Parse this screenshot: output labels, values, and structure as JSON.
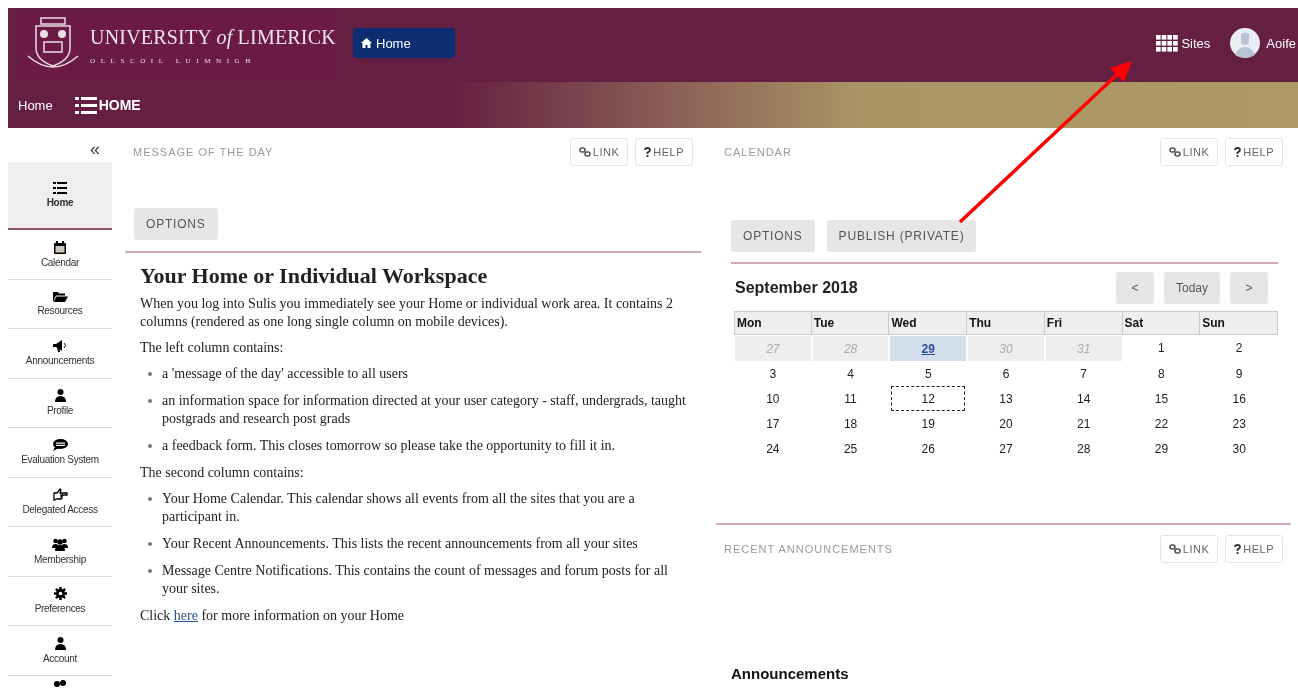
{
  "header": {
    "logo_title": "UNIVERSITY *of* LIMERICK",
    "logo_subtitle": "OLLSCOIL LUIMNIGH",
    "home_button": "Home",
    "sites": "Sites",
    "user": "Aoife"
  },
  "breadcrumb": {
    "home": "Home",
    "current": "HOME"
  },
  "sidebar": {
    "collapse": "«",
    "items": [
      {
        "label": "Home",
        "selected": true
      },
      {
        "label": "Calendar",
        "selected": false
      },
      {
        "label": "Resources",
        "selected": false
      },
      {
        "label": "Announcements",
        "selected": false
      },
      {
        "label": "Profile",
        "selected": false
      },
      {
        "label": "Evaluation System",
        "selected": false
      },
      {
        "label": "Delegated Access",
        "selected": false
      },
      {
        "label": "Membership",
        "selected": false
      },
      {
        "label": "Preferences",
        "selected": false
      },
      {
        "label": "Account",
        "selected": false
      }
    ]
  },
  "message_of_the_day": {
    "title": "MESSAGE OF THE DAY",
    "link": "LINK",
    "help": "HELP",
    "options": "OPTIONS",
    "heading": "Your Home or Individual Workspace",
    "blocks": [
      {
        "kind": "p",
        "text": "When you log into Sulis you immediately see your Home or individual work area. It contains 2 columns (rendered as one long single column on mobile devices)."
      },
      {
        "kind": "p",
        "text": "The left column contains:"
      },
      {
        "kind": "ul",
        "items": [
          "a 'message of the day'  accessible to all users",
          "an information space for information directed at your user category -  staff, undergrads, taught postgrads and research post grads",
          "a feedback form. This closes tomorrow so please take the opportunity to fill it in."
        ]
      },
      {
        "kind": "p",
        "text": "The second column contains:"
      },
      {
        "kind": "ul",
        "items": [
          "Your Home Calendar. This calendar shows all events from all the sites that you are a participant in.",
          "Your Recent Announcements. This lists the recent announcements from all your sites",
          "Message Centre Notifications. This contains the count of messages and forum posts for all your sites."
        ]
      },
      {
        "kind": "link_p",
        "before": "Click",
        "link": "here",
        "after": "for more information on your Home"
      }
    ]
  },
  "calendar": {
    "title": "CALENDAR",
    "link": "LINK",
    "help": "HELP",
    "options": "OPTIONS",
    "publish": "PUBLISH (PRIVATE)",
    "month": "September 2018",
    "prev": "<",
    "today": "Today",
    "next": ">",
    "weekdays": [
      "Mon",
      "Tue",
      "Wed",
      "Thu",
      "Fri",
      "Sat",
      "Sun"
    ],
    "weeks": [
      [
        {
          "day": "27",
          "muted": true,
          "selected": false,
          "today": false
        },
        {
          "day": "28",
          "muted": true,
          "selected": false,
          "today": false
        },
        {
          "day": "29",
          "muted": true,
          "selected": true,
          "today": false
        },
        {
          "day": "30",
          "muted": true,
          "selected": false,
          "today": false
        },
        {
          "day": "31",
          "muted": true,
          "selected": false,
          "today": false
        },
        {
          "day": "1",
          "muted": false,
          "selected": false,
          "today": false
        },
        {
          "day": "2",
          "muted": false,
          "selected": false,
          "today": false
        }
      ],
      [
        {
          "day": "3",
          "muted": false,
          "selected": false,
          "today": false
        },
        {
          "day": "4",
          "muted": false,
          "selected": false,
          "today": false
        },
        {
          "day": "5",
          "muted": false,
          "selected": false,
          "today": false
        },
        {
          "day": "6",
          "muted": false,
          "selected": false,
          "today": false
        },
        {
          "day": "7",
          "muted": false,
          "selected": false,
          "today": false
        },
        {
          "day": "8",
          "muted": false,
          "selected": false,
          "today": false
        },
        {
          "day": "9",
          "muted": false,
          "selected": false,
          "today": false
        }
      ],
      [
        {
          "day": "10",
          "muted": false,
          "selected": false,
          "today": false
        },
        {
          "day": "11",
          "muted": false,
          "selected": false,
          "today": false
        },
        {
          "day": "12",
          "muted": false,
          "selected": false,
          "today": true
        },
        {
          "day": "13",
          "muted": false,
          "selected": false,
          "today": false
        },
        {
          "day": "14",
          "muted": false,
          "selected": false,
          "today": false
        },
        {
          "day": "15",
          "muted": false,
          "selected": false,
          "today": false
        },
        {
          "day": "16",
          "muted": false,
          "selected": false,
          "today": false
        }
      ],
      [
        {
          "day": "17",
          "muted": false,
          "selected": false,
          "today": false
        },
        {
          "day": "18",
          "muted": false,
          "selected": false,
          "today": false
        },
        {
          "day": "19",
          "muted": false,
          "selected": false,
          "today": false
        },
        {
          "day": "20",
          "muted": false,
          "selected": false,
          "today": false
        },
        {
          "day": "21",
          "muted": false,
          "selected": false,
          "today": false
        },
        {
          "day": "22",
          "muted": false,
          "selected": false,
          "today": false
        },
        {
          "day": "23",
          "muted": false,
          "selected": false,
          "today": false
        }
      ],
      [
        {
          "day": "24",
          "muted": false,
          "selected": false,
          "today": false
        },
        {
          "day": "25",
          "muted": false,
          "selected": false,
          "today": false
        },
        {
          "day": "26",
          "muted": false,
          "selected": false,
          "today": false
        },
        {
          "day": "27",
          "muted": false,
          "selected": false,
          "today": false
        },
        {
          "day": "28",
          "muted": false,
          "selected": false,
          "today": false
        },
        {
          "day": "29",
          "muted": false,
          "selected": false,
          "today": false
        },
        {
          "day": "30",
          "muted": false,
          "selected": false,
          "today": false
        }
      ]
    ]
  },
  "recent_announcements": {
    "title": "RECENT ANNOUNCEMENTS",
    "link": "LINK",
    "help": "HELP",
    "heading": "Announcements"
  },
  "annotation": {
    "kind": "arrow"
  }
}
